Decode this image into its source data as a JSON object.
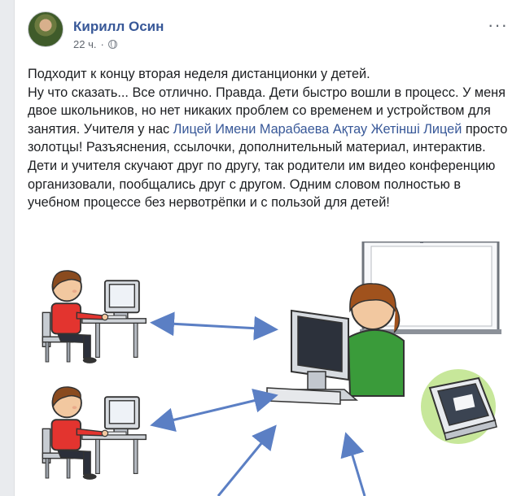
{
  "post": {
    "author": "Кирилл Осин",
    "time": "22 ч.",
    "dot": "·",
    "more": "···",
    "line1": "Подходит к концу вторая неделя дистанционки у детей.",
    "text_part1": "Ну что сказать... Все отлично. Правда. Дети быстро вошли в процесс. У меня двое школьников, но нет никаких проблем со временем и устройством для занятия. Учителя у нас ",
    "school_link": "Лицей Имени Марабаева Ақтау Жетінші Лицей",
    "text_part2": " просто золотцы! Разъяснения, ссылочки, дополнительный материал, интерактив. Дети и учителя скучают друг по другу, так родители им видео конференцию организовали, пообщались друг с другом. Одним словом полностью в учебном процессе без нервотрёпки и с пользой для детей!"
  },
  "colors": {
    "link": "#385898",
    "text": "#1c1e21",
    "meta": "#616770",
    "arrow": "#5b7fc4",
    "shirt_red": "#e3342f",
    "teacher_shirt": "#3a9b3a",
    "scanner_bg": "#c7e79a"
  },
  "icons": [
    "globe-icon",
    "more-options-icon"
  ]
}
